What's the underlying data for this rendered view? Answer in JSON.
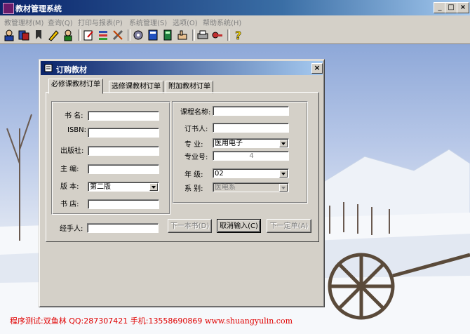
{
  "window": {
    "title": "教材管理系统"
  },
  "menu": [
    {
      "label": "教管理材(M)"
    },
    {
      "label": "查询(Q)"
    },
    {
      "label": "打印与报表(P)"
    },
    {
      "label": "系统管理(S)"
    },
    {
      "label": "选项(O)"
    },
    {
      "label": "帮助系统(H)"
    }
  ],
  "toolbar_icons": [
    "user-icon",
    "users-icon",
    "bookmark-icon",
    "pencil-icon",
    "person-icon",
    "document-edit-icon",
    "list-icon",
    "tools-icon",
    "gear-icon",
    "book-icon",
    "calculator-icon",
    "hand-icon",
    "printer-icon",
    "key-icon",
    "help-icon"
  ],
  "dialog": {
    "title": "订购教材",
    "tabs": [
      "必修课教材订单",
      "选修课教材订单",
      "附加教材订单"
    ],
    "left": {
      "book_name_label": "书  名:",
      "isbn_label": "ISBN:",
      "publisher_label": "出版社:",
      "editor_label": "主  编:",
      "edition_label": "版  本:",
      "edition_value": "第二版",
      "bookstore_label": "书  店:"
    },
    "right": {
      "course_name_label": "课程名称:",
      "orderer_label": "订书人:",
      "major_label": "专  业:",
      "major_value": "医用电子",
      "major_no_label": "专业号:",
      "major_no_value": "4",
      "grade_label": "年  级:",
      "grade_value": "02",
      "dept_label": "系  别:",
      "dept_value": "医电系"
    },
    "handler_label": "经手人:",
    "buttons": {
      "next_book": "下一本书(D)",
      "cancel_input": "取消输入(C)",
      "next_order": "下一定单(A)"
    }
  },
  "footer": {
    "tester": "程序测试:双鱼林",
    "qq": "QQ:287307421",
    "phone": "手机:13558690869",
    "url": "www.shuangyulin.com"
  },
  "colors": {
    "titlebar": "#0a246a",
    "face": "#d4d0c8",
    "footer_text": "#e00000"
  }
}
